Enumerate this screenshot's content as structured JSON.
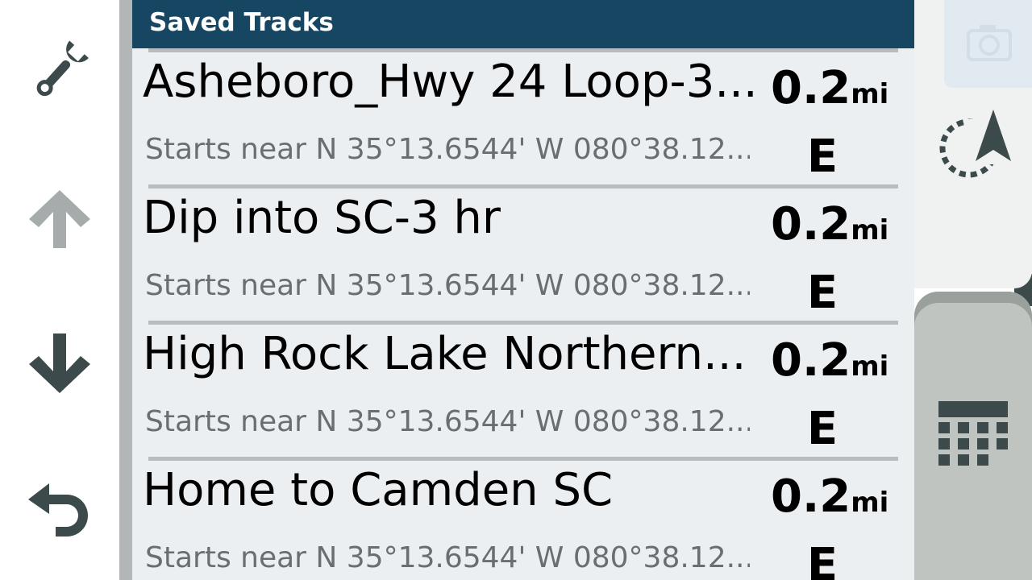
{
  "panel": {
    "title": "Saved Tracks"
  },
  "tracks": [
    {
      "name": "Asheboro_Hwy 24 Loop-3...",
      "subtitle": "Starts near N 35°13.6544' W 080°38.12...",
      "distance_value": "0.2",
      "distance_unit": "mi",
      "direction": "E"
    },
    {
      "name": "Dip into SC-3 hr",
      "subtitle": "Starts near N 35°13.6544' W 080°38.12...",
      "distance_value": "0.2",
      "distance_unit": "mi",
      "direction": "E"
    },
    {
      "name": "High Rock Lake Northern...",
      "subtitle": "Starts near N 35°13.6544' W 080°38.12...",
      "distance_value": "0.2",
      "distance_unit": "mi",
      "direction": "E"
    },
    {
      "name": "Home to Camden SC",
      "subtitle": "Starts near N 35°13.6544' W 080°38.12...",
      "distance_value": "0.2",
      "distance_unit": "mi",
      "direction": "E"
    }
  ],
  "toolbar": {
    "icons": [
      "wrench-icon",
      "arrow-up-icon",
      "arrow-down-icon",
      "back-icon"
    ]
  },
  "right_panel": {
    "icons": [
      "camera-icon",
      "navigation-arrow-icon",
      "keypad-icon"
    ]
  },
  "colors": {
    "header": "#174663",
    "panel_bg": "#ebeff2",
    "icon_dark": "#3d4a4c",
    "icon_disabled": "#a6acab",
    "subtitle_text": "#6a6e71"
  }
}
